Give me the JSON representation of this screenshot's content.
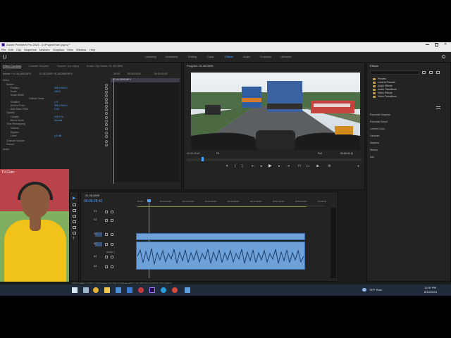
{
  "window": {
    "title": "Adobe Premiere Pro 2019 - D:\\Project\\Fam.prproj *",
    "menu": [
      "File",
      "Edit",
      "Clip",
      "Sequence",
      "Markers",
      "Graphics",
      "View",
      "Window",
      "Help"
    ]
  },
  "workspaces": {
    "tabs": [
      "Learning",
      "Assembly",
      "Editing",
      "Color",
      "Effects",
      "Audio",
      "Graphics",
      "Libraries"
    ],
    "active": "Effects"
  },
  "effect_controls": {
    "tabs": [
      "Effect Controls",
      "Lumetri Scopes",
      "Source: (no clips)",
      "Audio Clip Mixer: 01.08.2895"
    ],
    "source_label": "Master * 01.08.2895.MP4",
    "clip_label": "01.08.2895 * 01.08.2895.MP4",
    "ruler": [
      "00:00",
      "00:04:16:00",
      "00:00:32:00"
    ],
    "clip_bar": "01.08.2895.MP4",
    "section_video": "Video",
    "section_audio": "Audio",
    "properties": [
      {
        "name": "Motion",
        "value": ""
      },
      {
        "name": "Position",
        "value": "960.0  540.0"
      },
      {
        "name": "Scale",
        "value": "100.0"
      },
      {
        "name": "Scale Width",
        "value": ""
      },
      {
        "name": "Uniform Scale",
        "value": ""
      },
      {
        "name": "Rotation",
        "value": "0.0"
      },
      {
        "name": "Anchor Point",
        "value": "960.0  540.0"
      },
      {
        "name": "Anti-flicker Filter",
        "value": "0.00"
      },
      {
        "name": "Opacity",
        "value": ""
      },
      {
        "name": "Opacity",
        "value": "100.0 %"
      },
      {
        "name": "Blend Mode",
        "value": "Normal"
      },
      {
        "name": "Time Remapping",
        "value": ""
      },
      {
        "name": "Volume",
        "value": ""
      },
      {
        "name": "Bypass",
        "value": ""
      },
      {
        "name": "Level",
        "value": "0.0 dB"
      },
      {
        "name": "Channel Volume",
        "value": ""
      },
      {
        "name": "Panner",
        "value": ""
      }
    ],
    "timecode": "00:05:28:42"
  },
  "program": {
    "title": "Program: 01.08.2895",
    "timecode_in": "00:05:28:42",
    "fit": "Fit",
    "quality": "Full",
    "timecode_out": "00:09:41:11"
  },
  "effects_panel": {
    "title": "Effects",
    "items": [
      "Presets",
      "Lumetri Presets",
      "Audio Effects",
      "Audio Transitions",
      "Video Effects",
      "Video Transitions"
    ],
    "sections": [
      "Essential Graphics",
      "Essential Sound",
      "Lumetri Color",
      "Libraries",
      "Markers",
      "History",
      "Info"
    ]
  },
  "timeline": {
    "tab": "01.08.2895",
    "timecode": "00:05:28:42",
    "ruler": [
      "00:00",
      "00:05:12:00",
      "00:17:04:00",
      "00:25:36:00",
      "00:34:08:00",
      "00:42:40:00",
      "00:51:12:00",
      "00:59:44:00",
      "01:08:16"
    ],
    "tracks": [
      "V3",
      "V2",
      "V1",
      "A1",
      "A2",
      "A3"
    ],
    "audio_label": "Audio 1",
    "status": "Click to select, or click in empty space and drag to marquee select. Use Shift, Alt, and Ctrl for other options."
  },
  "webcam": {
    "watermark": "TV.Com"
  },
  "taskbar": {
    "weather": "76°F  Rain",
    "time": "11:00 PM",
    "date": "8/14/2024"
  },
  "colors": {
    "accent": "#4aa3ff",
    "clip_blue": "#6ea0d9",
    "panel_bg": "#232323"
  }
}
